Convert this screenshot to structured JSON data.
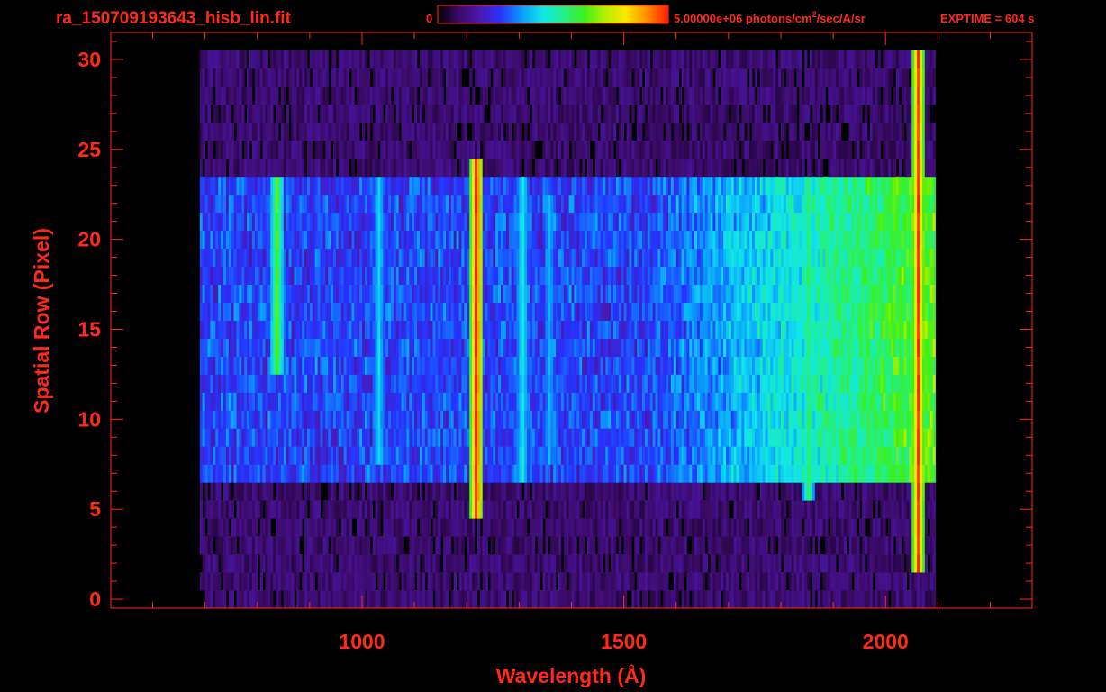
{
  "header": {
    "filename": "ra_150709193643_hisb_lin.fit",
    "colorbar_min_label": "0",
    "colorbar_max_label": "5.00000e+06 photons/cm",
    "colorbar_unit_sup": "2",
    "colorbar_unit_tail": "/sec/A/sr",
    "exptime_label": "EXPTIME = 604 s"
  },
  "colors": {
    "axis": "#ff2a1a",
    "background": "#000000",
    "colormap": [
      "#000000",
      "#3a0a66",
      "#4b18b0",
      "#2633ff",
      "#0a9cff",
      "#11e6ea",
      "#22f08a",
      "#3df01a",
      "#b4f000",
      "#ffe600",
      "#ff8a00",
      "#ff1a00"
    ]
  },
  "chart_data": {
    "type": "heatmap",
    "xlabel": "Wavelength (Å)",
    "ylabel": "Spatial Row (Pixel)",
    "xlim": [
      520,
      2280
    ],
    "ylim": [
      -0.5,
      31.5
    ],
    "x_ticks": [
      1000,
      1500,
      2000
    ],
    "x_tick_labels": [
      "1000",
      "1500",
      "2000"
    ],
    "y_ticks": [
      0,
      5,
      10,
      15,
      20,
      25,
      30
    ],
    "y_tick_labels": [
      "0",
      "5",
      "10",
      "15",
      "20",
      "25",
      "30"
    ],
    "color_scale_max": 5000000,
    "color_scale_min": 0,
    "spectral_extent_angstrom": [
      690,
      2095
    ],
    "spatial_rows": [
      0,
      30
    ],
    "grid": false,
    "emission_features": [
      {
        "wavelength": 835,
        "rows": [
          13,
          23
        ],
        "level": 0.62
      },
      {
        "wavelength": 1030,
        "rows": [
          8,
          23
        ],
        "level": 0.42
      },
      {
        "wavelength": 1216,
        "rows": [
          5,
          24
        ],
        "level": 1.0
      },
      {
        "wavelength": 1304,
        "rows": [
          7,
          23
        ],
        "level": 0.45
      },
      {
        "wavelength": 1356,
        "rows": [
          8,
          22
        ],
        "level": 0.38
      },
      {
        "wavelength": 1850,
        "rows": [
          6,
          23
        ],
        "level": 0.55
      },
      {
        "wavelength": 2060,
        "rows": [
          2,
          30
        ],
        "level": 0.95
      }
    ]
  }
}
